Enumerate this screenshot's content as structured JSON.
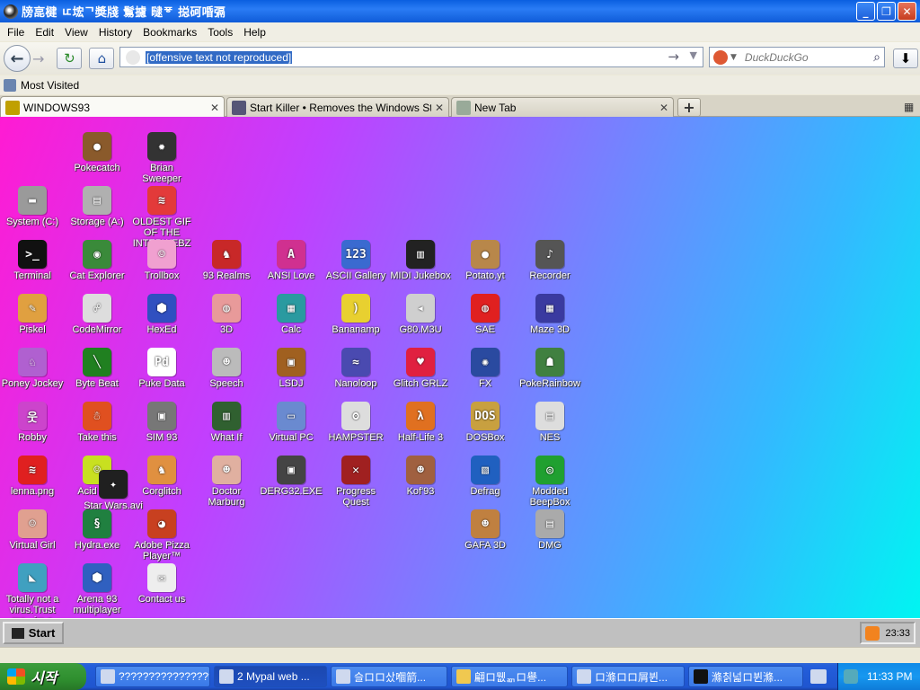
{
  "window": {
    "title": "牓㖜楗 ㅦ㙆ᄀ奬牋 鬄攄 曃ᅗ 搃砢㖧㣂"
  },
  "menu": [
    "File",
    "Edit",
    "View",
    "History",
    "Bookmarks",
    "Tools",
    "Help"
  ],
  "nav": {
    "url": "[offensive text not reproduced]",
    "search_placeholder": "DuckDuckGo"
  },
  "bookmarks": {
    "most_visited": "Most Visited"
  },
  "tabs": [
    {
      "label": "WINDOWS93",
      "active": true
    },
    {
      "label": "Start Killer • Removes the Windows Start...",
      "active": false
    },
    {
      "label": "New Tab",
      "active": false
    }
  ],
  "desktop": {
    "icons": [
      {
        "label": "Pokecatch",
        "color": "#8a5a2b",
        "glyph": "●"
      },
      {
        "label": "Brian Sweeper",
        "color": "#333333",
        "glyph": "✹"
      },
      {
        "label": "System (C:)",
        "color": "#9a9a9a",
        "glyph": "▬"
      },
      {
        "label": "Storage (A:)",
        "color": "#b0b0b0",
        "glyph": "▤"
      },
      {
        "label": "OLDEST GIF OF THE INTERWEBZ",
        "color": "#e33a3a",
        "glyph": "≋"
      },
      {
        "label": "Terminal",
        "color": "#111111",
        "glyph": ">_"
      },
      {
        "label": "Cat Explorer",
        "color": "#3a8a3a",
        "glyph": "◉"
      },
      {
        "label": "Trollbox",
        "color": "#f0a0d0",
        "glyph": "☺"
      },
      {
        "label": "93 Realms",
        "color": "#c82828",
        "glyph": "♞"
      },
      {
        "label": "ANSI Love",
        "color": "#d03090",
        "glyph": "A"
      },
      {
        "label": "ASCII Gallery",
        "color": "#3a6ad0",
        "glyph": "123"
      },
      {
        "label": "MIDI Jukebox",
        "color": "#222222",
        "glyph": "▥"
      },
      {
        "label": "Potato.yt",
        "color": "#b8874a",
        "glyph": "●"
      },
      {
        "label": "Recorder",
        "color": "#555555",
        "glyph": "♪"
      },
      {
        "label": "Piskel",
        "color": "#e0a040",
        "glyph": "✎"
      },
      {
        "label": "CodeMirror",
        "color": "#dddddd",
        "glyph": "☍"
      },
      {
        "label": "HexEd",
        "color": "#3050c0",
        "glyph": "⬢"
      },
      {
        "label": "3D",
        "color": "#e89a9a",
        "glyph": "◍"
      },
      {
        "label": "Calc",
        "color": "#2a9aa0",
        "glyph": "▦"
      },
      {
        "label": "Bananamp",
        "color": "#e8d030",
        "glyph": ")"
      },
      {
        "label": "G80.M3U",
        "color": "#cfcfcf",
        "glyph": "◂"
      },
      {
        "label": "SAE",
        "color": "#e02020",
        "glyph": "◍"
      },
      {
        "label": "Maze 3D",
        "color": "#3a3aa0",
        "glyph": "▦"
      },
      {
        "label": "Poney Jockey",
        "color": "#b060d0",
        "glyph": "♘"
      },
      {
        "label": "Byte Beat",
        "color": "#208020",
        "glyph": "╲"
      },
      {
        "label": "Puke Data",
        "color": "#ffffff",
        "glyph": "Pd"
      },
      {
        "label": "Speech",
        "color": "#bbbbbb",
        "glyph": "☻"
      },
      {
        "label": "LSDJ",
        "color": "#a06020",
        "glyph": "▣"
      },
      {
        "label": "Nanoloop",
        "color": "#4a4ab0",
        "glyph": "≈"
      },
      {
        "label": "Glitch GRLZ",
        "color": "#e02040",
        "glyph": "♥"
      },
      {
        "label": "FX",
        "color": "#2a4aa0",
        "glyph": "✺"
      },
      {
        "label": "PokeRainbow",
        "color": "#408040",
        "glyph": "☗"
      },
      {
        "label": "Robby",
        "color": "#cc44cc",
        "glyph": "웃"
      },
      {
        "label": "Take this",
        "color": "#e05020",
        "glyph": "☃"
      },
      {
        "label": "SIM 93",
        "color": "#777777",
        "glyph": "▣"
      },
      {
        "label": "What If",
        "color": "#306030",
        "glyph": "▥"
      },
      {
        "label": "Virtual PC",
        "color": "#6a8ad0",
        "glyph": "▭"
      },
      {
        "label": "HAMPSTER",
        "color": "#dddddd",
        "glyph": "ʘ"
      },
      {
        "label": "Half-Life 3",
        "color": "#e07020",
        "glyph": "λ"
      },
      {
        "label": "DOSBox",
        "color": "#c8a040",
        "glyph": "DOS"
      },
      {
        "label": "NES",
        "color": "#dddddd",
        "glyph": "▤"
      },
      {
        "label": "lenna.png",
        "color": "#e02020",
        "glyph": "≋"
      },
      {
        "label": "Acid Box",
        "color": "#c8e020",
        "glyph": "☺"
      },
      {
        "label": "Corglitch",
        "color": "#e09040",
        "glyph": "♞"
      },
      {
        "label": "Doctor Marburg",
        "color": "#e0b0a0",
        "glyph": "☻"
      },
      {
        "label": "DERG32.EXE",
        "color": "#444444",
        "glyph": "▣"
      },
      {
        "label": "Progress Quest",
        "color": "#a02020",
        "glyph": "✕"
      },
      {
        "label": "Kof'93",
        "color": "#a06040",
        "glyph": "☻"
      },
      {
        "label": "Defrag",
        "color": "#2060c0",
        "glyph": "▧"
      },
      {
        "label": "Modded BeepBox",
        "color": "#20a030",
        "glyph": "◎"
      },
      {
        "label": "Star Wars.avi",
        "color": "#202020",
        "glyph": "✦"
      },
      {
        "label": "Virtual Girl",
        "color": "#e0a090",
        "glyph": "☺"
      },
      {
        "label": "Hydra.exe",
        "color": "#208040",
        "glyph": "§"
      },
      {
        "label": "Adobe Pizza Player™",
        "color": "#c84020",
        "glyph": "◕"
      },
      {
        "label": "GAFA 3D",
        "color": "#c08040",
        "glyph": "☻"
      },
      {
        "label": "DMG",
        "color": "#aaaaaa",
        "glyph": "▤"
      },
      {
        "label": "Totally not a virus.Trust me...im a",
        "color": "#40a0c0",
        "glyph": "◣"
      },
      {
        "label": "Arena 93 multiplayer",
        "color": "#3060c0",
        "glyph": "⬢"
      },
      {
        "label": "Contact us",
        "color": "#eeeeee",
        "glyph": "✉"
      }
    ]
  },
  "w93": {
    "start_label": "Start",
    "clock": "23:33"
  },
  "taskbar": {
    "start_label": "시작",
    "items": [
      {
        "label": "???????????????????..."
      },
      {
        "label": "2 Mypal web ..."
      },
      {
        "label": "슬ロロ샀嗰箭..."
      },
      {
        "label": "翩ロ뭾ᇑロ譽..."
      },
      {
        "label": "ロ滌ロロ屑뷘..."
      },
      {
        "label": "滌칡넓ロ뷘滌..."
      }
    ],
    "clock": "11:33 PM"
  }
}
